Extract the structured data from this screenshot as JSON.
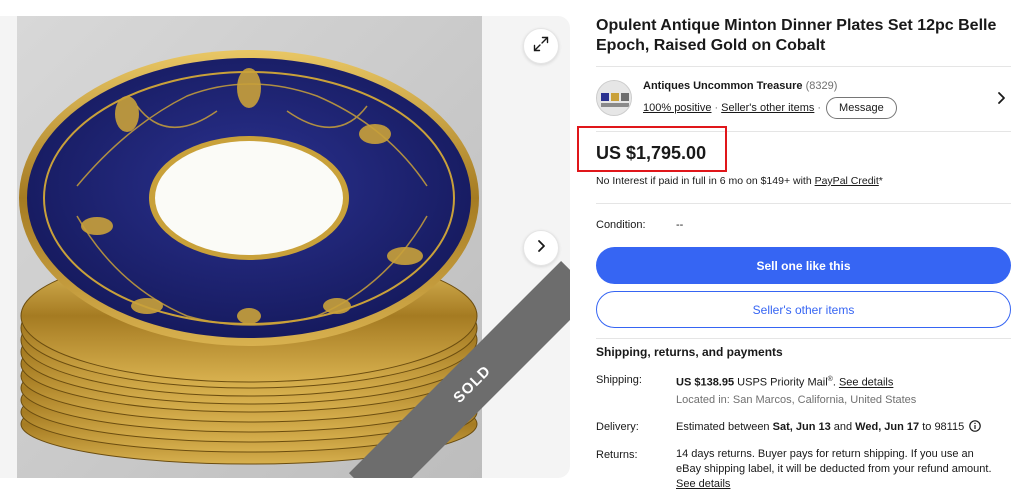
{
  "listing": {
    "title": "Opulent Antique Minton Dinner Plates Set 12pc Belle Epoch, Raised Gold on Cobalt",
    "sold_badge": "SOLD"
  },
  "seller": {
    "name": "Antiques Uncommon Treasure",
    "feedback_count": "(8329)",
    "positive": "100% positive",
    "other_items_link": "Seller's other items",
    "message_button": "Message"
  },
  "price": {
    "amount": "US $1,795.00",
    "finance_text": "No Interest if paid in full in 6 mo on $149+ with ",
    "finance_link": "PayPal Credit",
    "finance_suffix": "*"
  },
  "condition": {
    "label": "Condition:",
    "value": "--"
  },
  "actions": {
    "primary": "Sell one like this",
    "secondary": "Seller's other items"
  },
  "shipping": {
    "heading": "Shipping, returns, and payments",
    "shipping_label": "Shipping:",
    "shipping_price": "US $138.95",
    "shipping_service": "USPS Priority Mail",
    "shipping_reg": "®",
    "shipping_link": "See details",
    "location": "Located in: San Marcos, California, United States",
    "delivery_label": "Delivery:",
    "delivery_prefix": "Estimated between ",
    "delivery_start": "Sat, Jun 13",
    "delivery_and": " and ",
    "delivery_end": "Wed, Jun 17",
    "delivery_to": " to 98115",
    "returns_label": "Returns:",
    "returns_text": "14 days returns. Buyer pays for return shipping. If you use an eBay shipping label, it will be deducted from your refund amount.",
    "returns_link": "See details"
  },
  "colors": {
    "accent_blue": "#3665f3",
    "highlight_red": "#e0161a",
    "cobalt": "#1e2370",
    "gold": "#c9a13a"
  },
  "icons": [
    "expand-icon",
    "chevron-right-icon",
    "info-icon"
  ]
}
